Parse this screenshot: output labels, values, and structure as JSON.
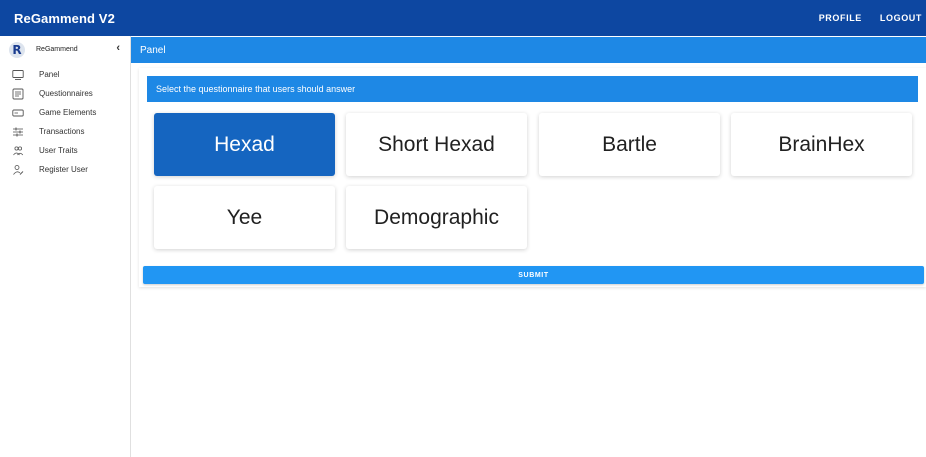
{
  "header": {
    "title": "ReGammend V2",
    "actions": [
      "PROFILE",
      "LOGOUT"
    ]
  },
  "sidebar": {
    "brand": "ReGammend",
    "logo_letter": "R",
    "collapse_icon": "chevron-left-icon",
    "items": [
      {
        "label": "Panel",
        "icon": "monitor-icon"
      },
      {
        "label": "Questionnaires",
        "icon": "list-icon"
      },
      {
        "label": "Game Elements",
        "icon": "card-icon"
      },
      {
        "label": "Transactions",
        "icon": "sliders-icon"
      },
      {
        "label": "User Traits",
        "icon": "users-icon"
      },
      {
        "label": "Register User",
        "icon": "user-edit-icon"
      }
    ]
  },
  "panel": {
    "title": "Panel"
  },
  "main": {
    "instruction": "Select the questionnaire that users should answer",
    "questionnaires": [
      {
        "label": "Hexad",
        "selected": true
      },
      {
        "label": "Short Hexad",
        "selected": false
      },
      {
        "label": "Bartle",
        "selected": false
      },
      {
        "label": "BrainHex",
        "selected": false
      },
      {
        "label": "Yee",
        "selected": false
      },
      {
        "label": "Demographic",
        "selected": false
      }
    ],
    "submit_label": "SUBMIT"
  },
  "colors": {
    "topbar": "#0d47a1",
    "panel_bar": "#1e88e5",
    "selected_card": "#1565c0",
    "submit": "#2196f3"
  }
}
